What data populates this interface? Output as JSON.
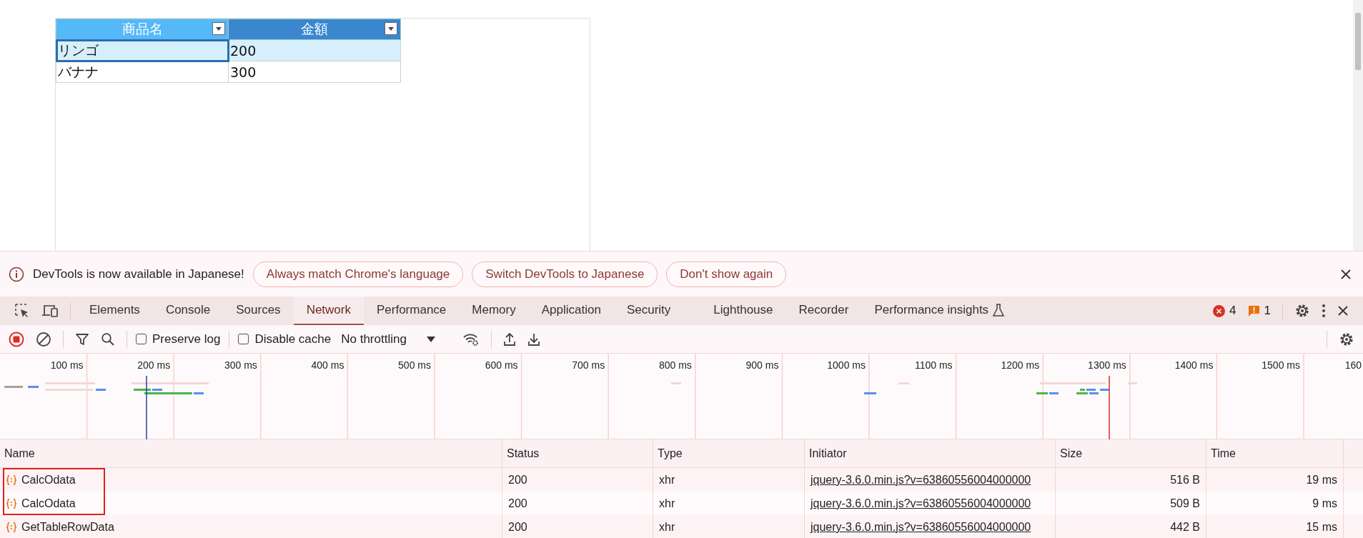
{
  "sheet": {
    "columns": [
      {
        "label": "商品名",
        "selected": false
      },
      {
        "label": "金額",
        "selected": true
      }
    ],
    "rows": [
      {
        "selected": true,
        "cells": [
          {
            "text": "リンゴ",
            "focused": true
          },
          {
            "text": "200",
            "focused": false
          }
        ]
      },
      {
        "selected": false,
        "cells": [
          {
            "text": "バナナ",
            "focused": false
          },
          {
            "text": "300",
            "focused": false
          }
        ]
      }
    ]
  },
  "infobar": {
    "message": "DevTools is now available in Japanese!",
    "buttons": [
      "Always match Chrome's language",
      "Switch DevTools to Japanese",
      "Don't show again"
    ]
  },
  "tabs": [
    {
      "label": "Elements",
      "selected": false,
      "experimental": false
    },
    {
      "label": "Console",
      "selected": false,
      "experimental": false
    },
    {
      "label": "Sources",
      "selected": false,
      "experimental": false
    },
    {
      "label": "Network",
      "selected": true,
      "experimental": false
    },
    {
      "label": "Performance",
      "selected": false,
      "experimental": false
    },
    {
      "label": "Memory",
      "selected": false,
      "experimental": false
    },
    {
      "label": "Application",
      "selected": false,
      "experimental": false
    },
    {
      "label": "Security",
      "selected": false,
      "experimental": false
    },
    {
      "label": "Lighthouse",
      "selected": false,
      "experimental": false
    },
    {
      "label": "Recorder",
      "selected": false,
      "experimental": false
    },
    {
      "label": "Performance insights",
      "selected": false,
      "experimental": true
    }
  ],
  "issues": {
    "errors": "4",
    "warnings": "1"
  },
  "toolbar": {
    "checkboxes": [
      {
        "label": "Preserve log",
        "checked": false
      },
      {
        "label": "Disable cache",
        "checked": false
      }
    ],
    "throttling": "No throttling"
  },
  "timeline": {
    "ticks": [
      "100 ms",
      "200 ms",
      "300 ms",
      "400 ms",
      "500 ms",
      "600 ms",
      "700 ms",
      "800 ms",
      "900 ms",
      "1000 ms",
      "1100 ms",
      "1200 ms",
      "1300 ms",
      "1400 ms",
      "1500 ms",
      "160"
    ]
  },
  "requests": {
    "columns": [
      "Name",
      "Status",
      "Type",
      "Initiator",
      "Size",
      "Time"
    ],
    "rows": [
      {
        "name": "CalcOdata",
        "status": "200",
        "type": "xhr",
        "initiator": "jquery-3.6.0.min.js?v=63860556004000000",
        "size": "516 B",
        "time": "19 ms",
        "highlighted": true
      },
      {
        "name": "CalcOdata",
        "status": "200",
        "type": "xhr",
        "initiator": "jquery-3.6.0.min.js?v=63860556004000000",
        "size": "509 B",
        "time": "9 ms",
        "highlighted": true
      },
      {
        "name": "GetTableRowData",
        "status": "200",
        "type": "xhr",
        "initiator": "jquery-3.6.0.min.js?v=63860556004000000",
        "size": "442 B",
        "time": "15 ms",
        "highlighted": false
      }
    ]
  }
}
